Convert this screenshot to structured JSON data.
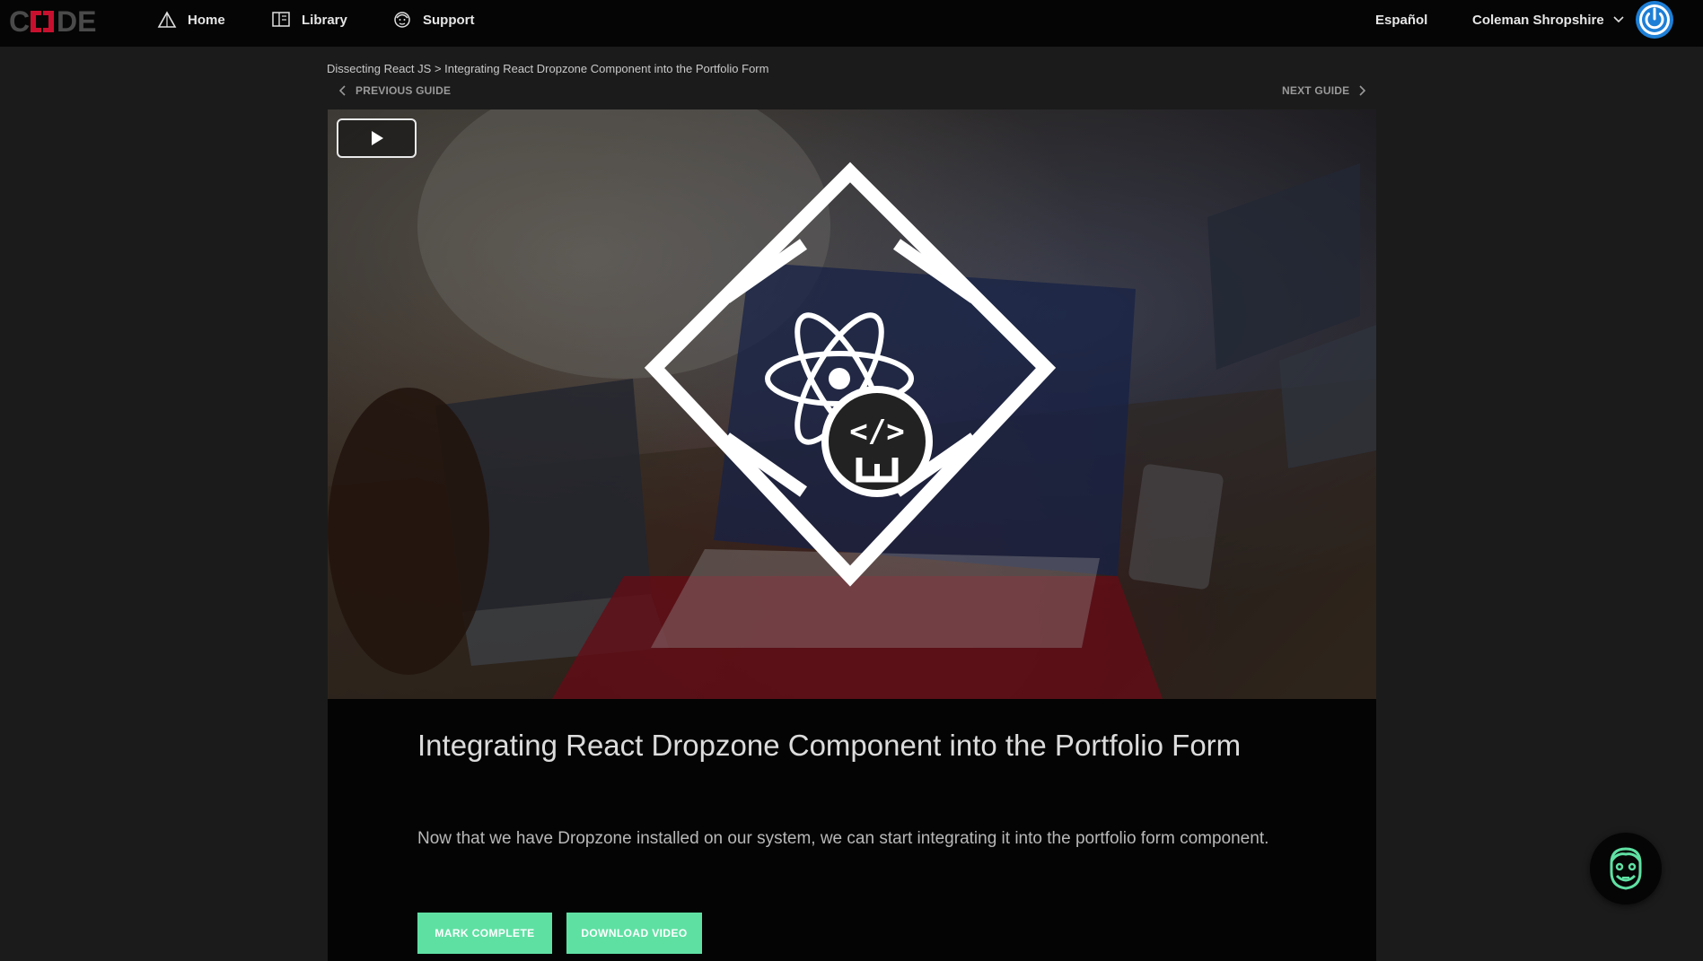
{
  "header": {
    "logo_text": "CODE",
    "nav": [
      {
        "label": "Home",
        "icon": "home-icon"
      },
      {
        "label": "Library",
        "icon": "book-icon"
      },
      {
        "label": "Support",
        "icon": "support-icon"
      }
    ],
    "language": "Español",
    "user_name": "Coleman Shropshire",
    "avatar_icon": "power-icon"
  },
  "breadcrumb": {
    "parent": "Dissecting React JS",
    "separator": " > ",
    "current": "Integrating React Dropzone Component into the Portfolio Form"
  },
  "guide_nav": {
    "previous": "PREVIOUS GUIDE",
    "next": "NEXT GUIDE"
  },
  "video": {
    "play_icon": "play-icon",
    "overlay_icon": "react-code-logo-icon"
  },
  "guide": {
    "title": "Integrating React Dropzone Component into the Portfolio Form",
    "description": "Now that we have Dropzone installed on our system, we can start integrating it into the portfolio form component.",
    "mark_complete": "MARK COMPLETE",
    "download_video": "DOWNLOAD VIDEO"
  },
  "chat": {
    "icon": "chat-bot-face-icon"
  },
  "colors": {
    "accent_green": "#5fe0a3",
    "logo_red": "#c8102e",
    "avatar_blue": "#1e7fd6",
    "topbar": "#050505",
    "page_bg": "#1b1b1b"
  }
}
